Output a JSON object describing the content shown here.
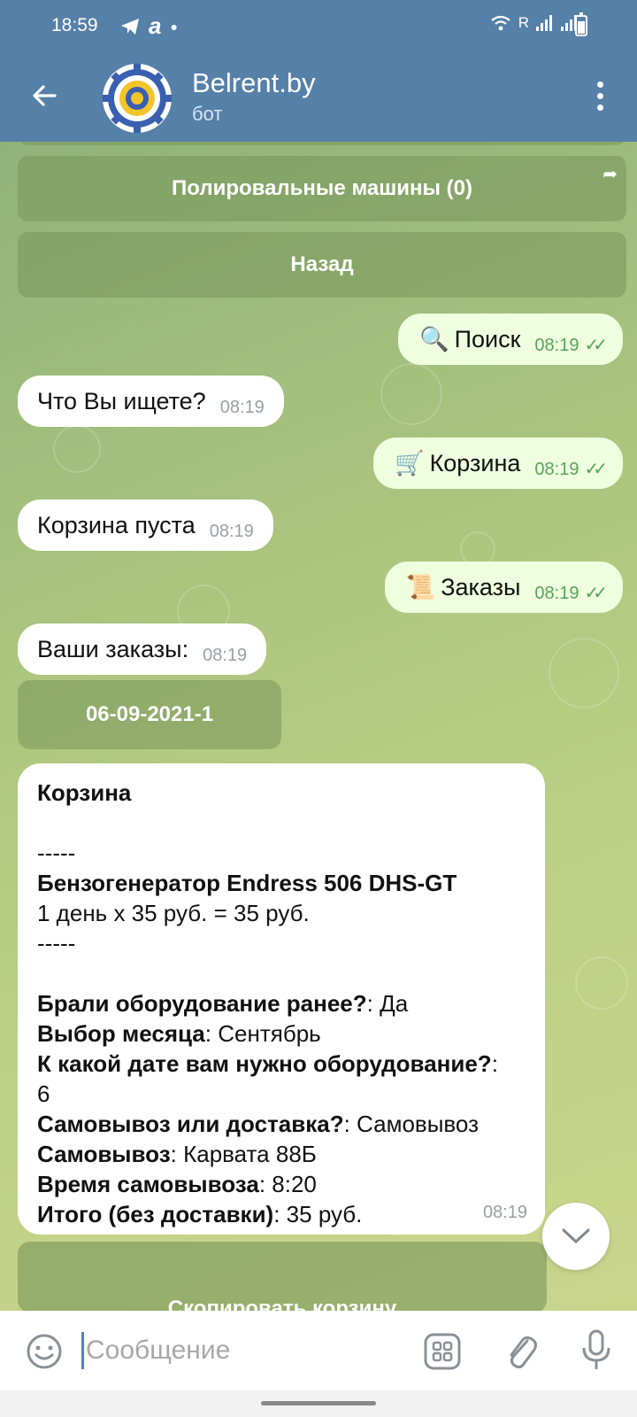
{
  "status": {
    "time": "18:59",
    "roaming": "R"
  },
  "header": {
    "title": "Belrent.by",
    "subtitle": "бот"
  },
  "keyboard": {
    "polish_machines": "Полировальные машины (0)",
    "back": "Назад"
  },
  "messages": [
    {
      "type": "out",
      "icon": "🔍",
      "text": "Поиск",
      "time": "08:19"
    },
    {
      "type": "in",
      "text": "Что Вы ищете?",
      "time": "08:19"
    },
    {
      "type": "out",
      "icon": "🛒",
      "text": "Корзина",
      "time": "08:19"
    },
    {
      "type": "in",
      "text": "Корзина пуста",
      "time": "08:19"
    },
    {
      "type": "out",
      "icon": "📜",
      "text": "Заказы",
      "time": "08:19"
    },
    {
      "type": "in",
      "text": "Ваши заказы:",
      "time": "08:19"
    }
  ],
  "order_button": "06-09-2021-1",
  "cart": {
    "title": "Корзина",
    "sep": "-----",
    "product": "Бензогенератор Endress 506 DHS-GT",
    "price_line": "1 день x 35 руб.  = 35 руб.",
    "rows": [
      {
        "label": "Брали оборудование ранее?",
        "value": " Да"
      },
      {
        "label": "Выбор месяца",
        "value": " Сентябрь"
      },
      {
        "label": "К какой дате вам нужно оборудование?",
        "value": " 6"
      },
      {
        "label": "Самовывоз или доставка?",
        "value": " Самовывоз"
      },
      {
        "label": "Самовывоз",
        "value": " Карвата 88Б"
      },
      {
        "label": "Время самовывоза",
        "value": " 8:20"
      },
      {
        "label": "Итого (без доставки)",
        "value": " 35 руб."
      }
    ],
    "time": "08:19"
  },
  "copy_button": "Скопировать корзину",
  "input": {
    "placeholder": "Сообщение"
  },
  "colors": {
    "header": "#5580a8",
    "out_bubble": "#eefedf",
    "check": "#5aa35a"
  }
}
